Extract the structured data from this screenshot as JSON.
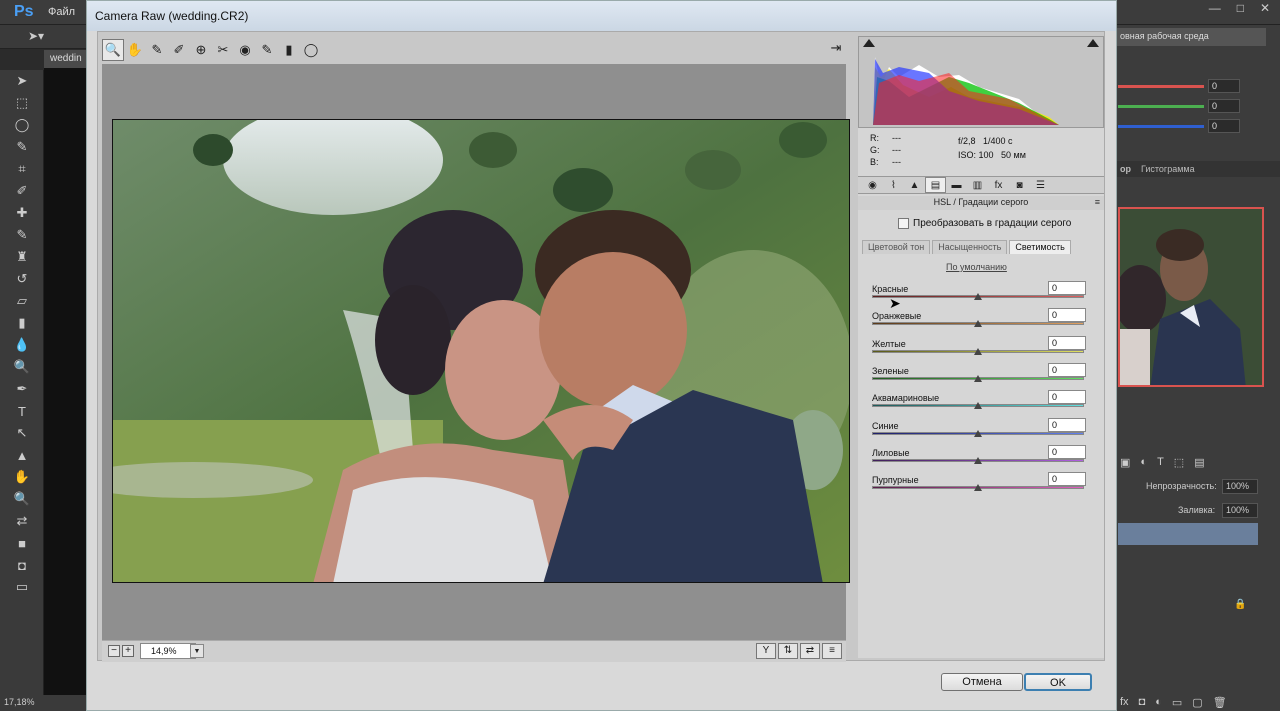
{
  "photoshop": {
    "logo": "Ps",
    "menu_file": "Файл",
    "doc_tab": "weddin",
    "status_zoom": "17,18%",
    "tool_icons": [
      "move-icon",
      "marquee-icon",
      "lasso-icon",
      "quick-select-icon",
      "crop-icon",
      "eyedropper-icon",
      "heal-icon",
      "brush-icon",
      "stamp-icon",
      "history-brush-icon",
      "eraser-icon",
      "gradient-icon",
      "blur-icon",
      "dodge-icon",
      "pen-icon",
      "type-icon",
      "path-select-icon",
      "shape-icon",
      "hand-icon",
      "zoom-icon"
    ]
  },
  "right_panels": {
    "workspace": "овная рабочая среда",
    "color_values": [
      "0",
      "0",
      "0"
    ],
    "color_slider_colors": [
      "#d9534f",
      "#4caf50",
      "#2f5fd0"
    ],
    "hist_tab_left": "ор",
    "hist_tab": "Гистограмма",
    "opacity_label": "Непрозрачность:",
    "opacity_value": "100%",
    "fill_label": "Заливка:",
    "fill_value": "100%"
  },
  "camera_raw": {
    "title": "Camera Raw (wedding.CR2)",
    "info": {
      "r_label": "R:",
      "g_label": "G:",
      "b_label": "B:",
      "r": "---",
      "g": "---",
      "b": "---",
      "aperture": "f/2,8",
      "shutter": "1/400 с",
      "iso": "ISO: 100",
      "focal": "50 мм"
    },
    "panel_title": "HSL / Градации серого",
    "grayscale_label": "Преобразовать в градации серого",
    "sub_tabs": [
      "Цветовой тон",
      "Насыщенность",
      "Светимость"
    ],
    "active_sub_tab": "Светимость",
    "defaults_link": "По умолчанию",
    "sliders": [
      {
        "label": "Красные",
        "value": "0",
        "gradient": [
          "#5a1f1f",
          "#e06060"
        ]
      },
      {
        "label": "Оранжевые",
        "value": "0",
        "gradient": [
          "#5a3a1a",
          "#e0a060"
        ]
      },
      {
        "label": "Желтые",
        "value": "0",
        "gradient": [
          "#5a5a1a",
          "#e0e060"
        ]
      },
      {
        "label": "Зеленые",
        "value": "0",
        "gradient": [
          "#1f5a1f",
          "#60e060"
        ]
      },
      {
        "label": "Аквамариновые",
        "value": "0",
        "gradient": [
          "#1f5a5a",
          "#60e0e0"
        ]
      },
      {
        "label": "Синие",
        "value": "0",
        "gradient": [
          "#1f1f6a",
          "#6080f0"
        ]
      },
      {
        "label": "Лиловые",
        "value": "0",
        "gradient": [
          "#3f1f5a",
          "#b060e0"
        ]
      },
      {
        "label": "Пурпурные",
        "value": "0",
        "gradient": [
          "#5a1f4a",
          "#e060c0"
        ]
      }
    ],
    "zoom_value": "14,9%",
    "cancel_label": "Отмена",
    "ok_label": "OK"
  }
}
